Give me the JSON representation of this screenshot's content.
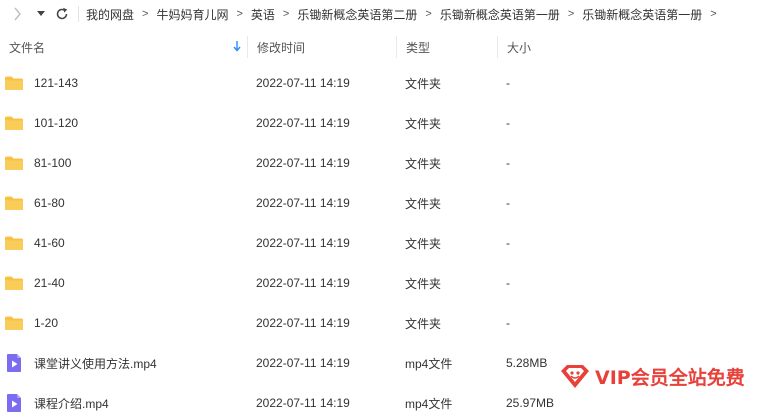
{
  "toolbar": {
    "back_icon": "chevron-left-icon",
    "dropdown_icon": "caret-down-icon",
    "refresh_icon": "refresh-icon"
  },
  "breadcrumb": [
    "我的网盘",
    "牛妈妈育儿网",
    "英语",
    "乐锄新概念英语第二册",
    "乐锄新概念英语第一册",
    "乐锄新概念英语第一册"
  ],
  "breadcrumb_separator": ">",
  "columns": {
    "name": "文件名",
    "modified": "修改时间",
    "type": "类型",
    "size": "大小"
  },
  "sort": {
    "column": "name",
    "icon": "sort-down-arrow-icon",
    "color": "#2b8cf7"
  },
  "files": [
    {
      "name": "121-143",
      "modified": "2022-07-11 14:19",
      "type": "文件夹",
      "size": "-",
      "icon": "folder-icon"
    },
    {
      "name": "101-120",
      "modified": "2022-07-11 14:19",
      "type": "文件夹",
      "size": "-",
      "icon": "folder-icon"
    },
    {
      "name": "81-100",
      "modified": "2022-07-11 14:19",
      "type": "文件夹",
      "size": "-",
      "icon": "folder-icon"
    },
    {
      "name": "61-80",
      "modified": "2022-07-11 14:19",
      "type": "文件夹",
      "size": "-",
      "icon": "folder-icon"
    },
    {
      "name": "41-60",
      "modified": "2022-07-11 14:19",
      "type": "文件夹",
      "size": "-",
      "icon": "folder-icon"
    },
    {
      "name": "21-40",
      "modified": "2022-07-11 14:19",
      "type": "文件夹",
      "size": "-",
      "icon": "folder-icon"
    },
    {
      "name": "1-20",
      "modified": "2022-07-11 14:19",
      "type": "文件夹",
      "size": "-",
      "icon": "folder-icon"
    },
    {
      "name": "课堂讲义使用方法.mp4",
      "modified": "2022-07-11 14:19",
      "type": "mp4文件",
      "size": "5.28MB",
      "icon": "video-file-icon"
    },
    {
      "name": "课程介绍.mp4",
      "modified": "2022-07-11 14:19",
      "type": "mp4文件",
      "size": "25.97MB",
      "icon": "video-file-icon"
    }
  ],
  "watermark": {
    "text": "VIP会员全站免费",
    "color": "#e8413a",
    "logo_icon": "vip-diamond-logo-icon"
  },
  "colors": {
    "folder": "#f7c244",
    "video_file": "#7b6cf0",
    "accent": "#2b8cf7"
  }
}
